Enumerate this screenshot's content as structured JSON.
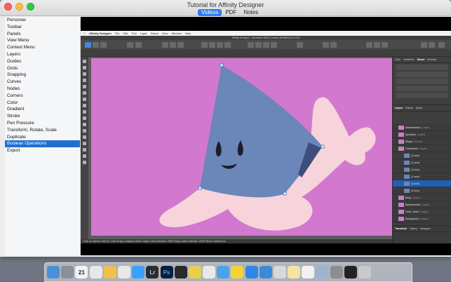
{
  "window": {
    "title": "Tutorial for Affinity Designer",
    "tabs": [
      "Videos",
      "PDF",
      "Notes"
    ],
    "active_tab": "Videos"
  },
  "sidebar": {
    "items": [
      "Personas",
      "Toolbar",
      "Panels",
      "View Menu",
      "Context Menu",
      "Layers",
      "Guides",
      "Grids",
      "Snapping",
      "Curves",
      "Nodes",
      "Corners",
      "Color",
      "Gradient",
      "Stroke",
      "Pen Pressure",
      "Transform, Rotate, Scale",
      "Duplicate",
      "Boolean Operations",
      "Export"
    ],
    "selected_index": 18
  },
  "video": {
    "app_menu": {
      "app_name": "Affinity Designer",
      "items": [
        "File",
        "Edit",
        "Text",
        "Layer",
        "Select",
        "View",
        "Window",
        "Help"
      ]
    },
    "document_title": "Affinity Designer - Adventure Ride (Locked) (Modified) (61.6%)",
    "panel_tabs": [
      "Color",
      "Swatches",
      "Stroke",
      "Brushes"
    ],
    "panel_tab_active": "Stroke",
    "layers_tabs": [
      "Layers",
      "Effects",
      "Styles"
    ],
    "layers": [
      {
        "name": "Marshmallow",
        "sub": "(Layer)",
        "child": false,
        "selected": false
      },
      {
        "name": "Sprinkles",
        "sub": "(Layer)",
        "child": false,
        "selected": false
      },
      {
        "name": "Shape",
        "sub": "(Curve)",
        "child": false,
        "selected": false
      },
      {
        "name": "Ghosthead",
        "sub": "(Layer)",
        "child": false,
        "selected": false
      },
      {
        "name": "(Curve)",
        "sub": "",
        "child": true,
        "selected": false
      },
      {
        "name": "(Curve)",
        "sub": "",
        "child": true,
        "selected": false
      },
      {
        "name": "(Curve)",
        "sub": "",
        "child": true,
        "selected": false
      },
      {
        "name": "(Curve)",
        "sub": "",
        "child": true,
        "selected": false
      },
      {
        "name": "(Curve)",
        "sub": "",
        "child": true,
        "selected": true
      },
      {
        "name": "(Curve)",
        "sub": "",
        "child": true,
        "selected": false
      },
      {
        "name": "Body",
        "sub": "(Layer)",
        "child": false,
        "selected": false
      },
      {
        "name": "Backlemosite",
        "sub": "(Layer)",
        "child": false,
        "selected": false
      },
      {
        "name": "Fade_Violet",
        "sub": "(Layer)",
        "child": false,
        "selected": false
      },
      {
        "name": "Background",
        "sub": "(Layer)",
        "child": false,
        "selected": false
      }
    ],
    "transform_tabs": [
      "Transform",
      "History",
      "Navigator"
    ],
    "status_text": "Click an object to select it. Click+Drag to marquee select. Drag to move selection. Shift+Drag to add to selection. Shift+Click to add/remove."
  },
  "colors": {
    "canvas": "#d278cf",
    "cone": "#6b86b8",
    "body": "#f7d3dc",
    "selection": "#1f6fd3"
  },
  "dock": {
    "icons": [
      "finder-icon",
      "launchpad-icon",
      "calendar-icon",
      "chrome-icon",
      "photos-icon",
      "itunes-icon",
      "messages-icon",
      "lightroom-icon",
      "photoshop-icon",
      "terminal-icon",
      "activity-monitor-icon",
      "chart-icon",
      "folder-icon",
      "cyberduck-icon",
      "app-store-icon",
      "xcode-icon",
      "files-icon",
      "notes-icon",
      "pages-icon",
      "folder2-icon",
      "system-preferences-icon",
      "tutorial-app-icon",
      "trash-icon"
    ],
    "calendar_day": "21",
    "lightroom_label": "Lr",
    "photoshop_label": "Ps"
  }
}
